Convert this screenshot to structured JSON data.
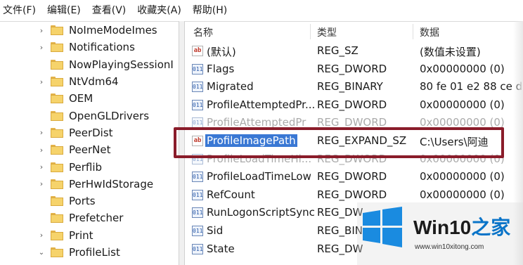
{
  "menubar": {
    "items": [
      {
        "label": "文件(F)"
      },
      {
        "label": "编辑(E)"
      },
      {
        "label": "查看(V)"
      },
      {
        "label": "收藏夹(A)"
      },
      {
        "label": "帮助(H)"
      }
    ]
  },
  "tree": {
    "items": [
      {
        "label": "NoImeModeImes",
        "arrow": "›"
      },
      {
        "label": "Notifications",
        "arrow": "›"
      },
      {
        "label": "NowPlayingSessionI",
        "arrow": ""
      },
      {
        "label": "NtVdm64",
        "arrow": "›"
      },
      {
        "label": "OEM",
        "arrow": ""
      },
      {
        "label": "OpenGLDrivers",
        "arrow": ""
      },
      {
        "label": "PeerDist",
        "arrow": "›"
      },
      {
        "label": "PeerNet",
        "arrow": "›"
      },
      {
        "label": "Perflib",
        "arrow": "›"
      },
      {
        "label": "PerHwIdStorage",
        "arrow": "›"
      },
      {
        "label": "Ports",
        "arrow": ""
      },
      {
        "label": "Prefetcher",
        "arrow": ""
      },
      {
        "label": "Print",
        "arrow": "›"
      },
      {
        "label": "ProfileList",
        "arrow": "⌄"
      }
    ]
  },
  "list": {
    "headers": {
      "name": "名称",
      "type": "类型",
      "data": "数据"
    },
    "rows": [
      {
        "icon": "ab",
        "name": "(默认)",
        "type": "REG_SZ",
        "data": "(数值未设置)"
      },
      {
        "icon": "bin",
        "name": "Flags",
        "type": "REG_DWORD",
        "data": "0x00000000 (0)"
      },
      {
        "icon": "bin",
        "name": "Migrated",
        "type": "REG_BINARY",
        "data": "80 fe 01 e2 88 ce d"
      },
      {
        "icon": "bin",
        "name": "ProfileAttemptedPr...",
        "type": "REG_DWORD",
        "data": "0x00000000 (0)"
      },
      {
        "icon": "bin",
        "name": "ProfileAttemptedPr",
        "type": "REG_DWORD",
        "data": "0x00000000 (0)"
      },
      {
        "icon": "ab",
        "name": "ProfileImagePath",
        "type": "REG_EXPAND_SZ",
        "data": "C:\\Users\\阿迪"
      },
      {
        "icon": "bin",
        "name": "ProfileLoadTimeHi...",
        "type": "REG_DWORD",
        "data": "0x00000000 (0)"
      },
      {
        "icon": "bin",
        "name": "ProfileLoadTimeLow",
        "type": "REG_DWORD",
        "data": "0x00000000 (0)"
      },
      {
        "icon": "bin",
        "name": "RefCount",
        "type": "REG_DWORD",
        "data": "0x00000000 (0)"
      },
      {
        "icon": "bin",
        "name": "RunLogonScriptSync",
        "type": "REG_DW",
        "data": ""
      },
      {
        "icon": "bin",
        "name": "Sid",
        "type": "REG_BIN",
        "data": ""
      },
      {
        "icon": "bin",
        "name": "State",
        "type": "REG_DW",
        "data": ""
      }
    ],
    "selected_row": "ProfileImagePath"
  },
  "watermark": {
    "title_main": "Win10",
    "title_accent": "之家",
    "url": "www.win10xitong.com",
    "logo": "windows-logo",
    "colors": {
      "accent": "#0a74c8",
      "logo": "#1a8be0"
    }
  },
  "colors": {
    "selection": "#3a78d4",
    "highlight_box": "#8a1c2a",
    "folder": "#f6d36b"
  }
}
